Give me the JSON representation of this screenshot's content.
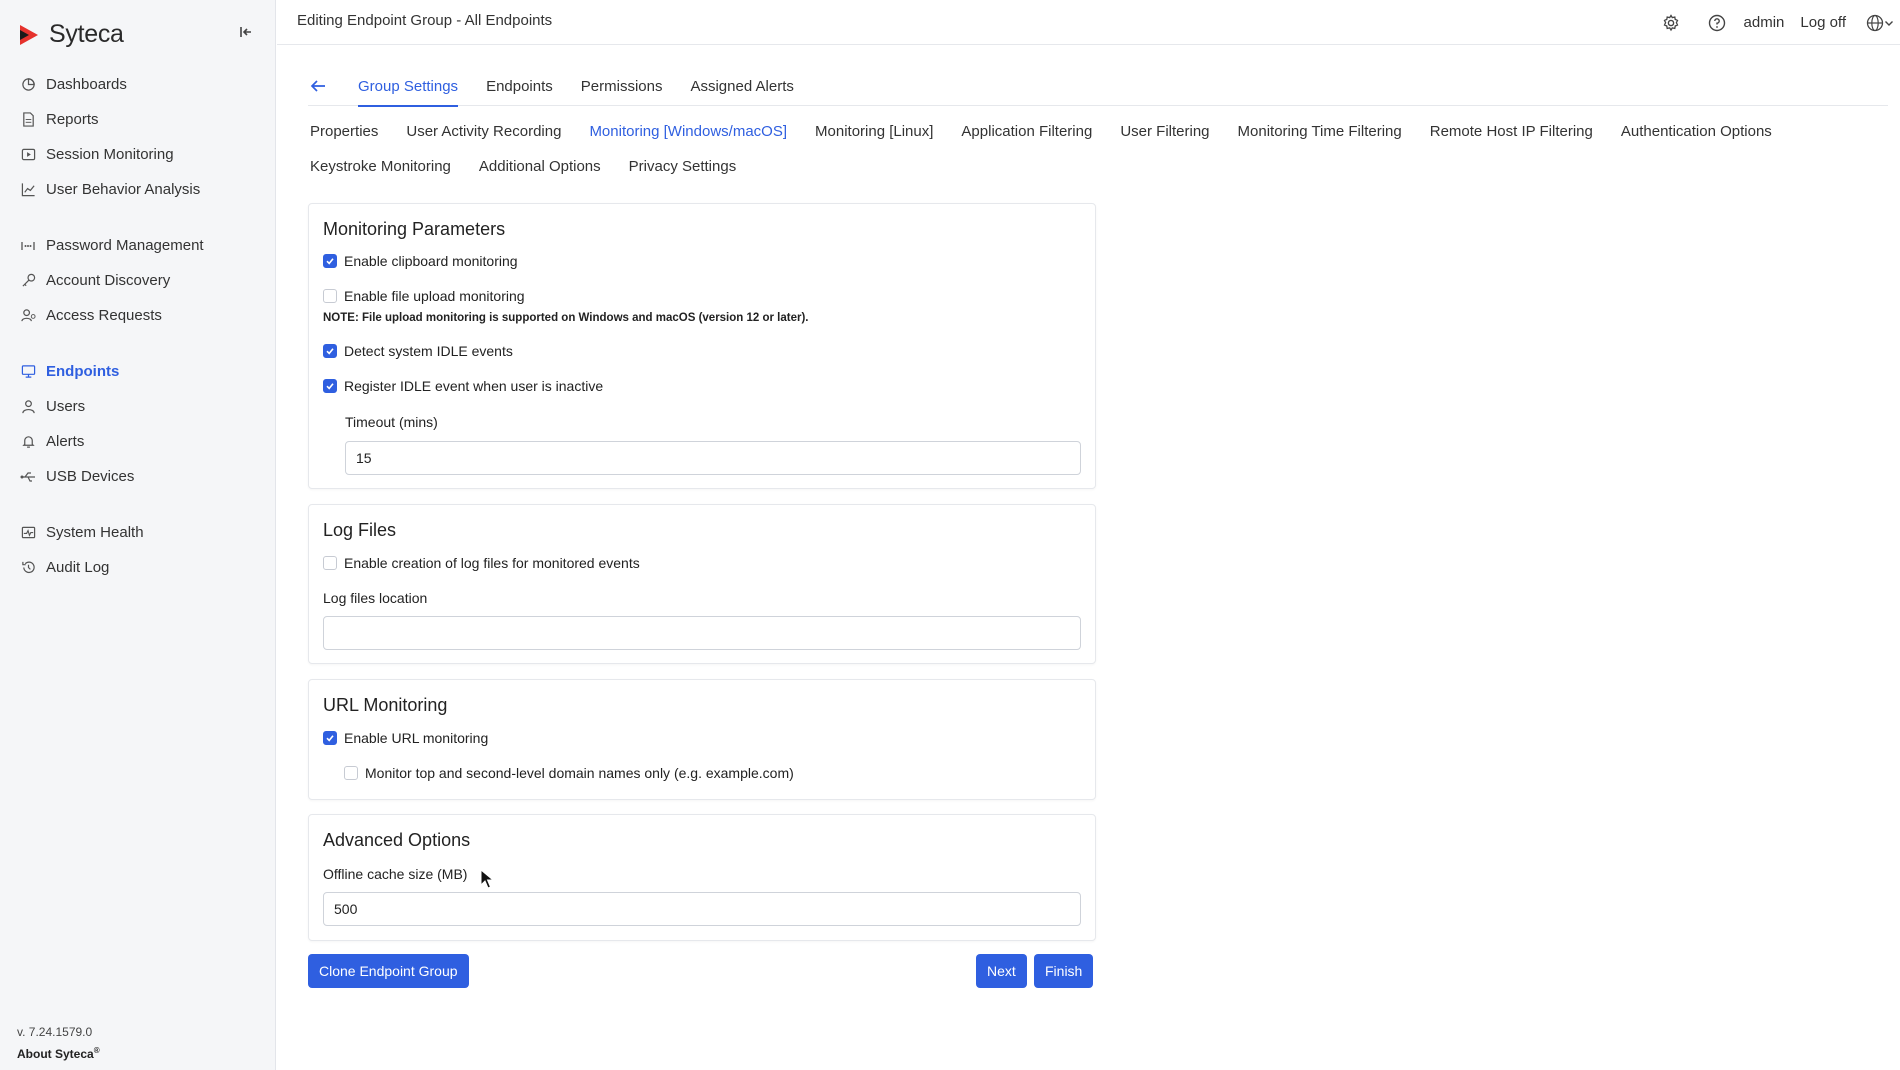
{
  "app": {
    "brand": "Syteca",
    "accent": "#2f5fe0"
  },
  "sidebar": {
    "groups": [
      {
        "items": [
          {
            "label": "Dashboards",
            "icon": "dashboard-icon"
          },
          {
            "label": "Reports",
            "icon": "report-icon"
          },
          {
            "label": "Session Monitoring",
            "icon": "session-icon"
          },
          {
            "label": "User Behavior Analysis",
            "icon": "chart-icon"
          }
        ]
      },
      {
        "items": [
          {
            "label": "Password Management",
            "icon": "password-icon"
          },
          {
            "label": "Account Discovery",
            "icon": "key-icon"
          },
          {
            "label": "Access Requests",
            "icon": "access-icon"
          }
        ]
      },
      {
        "items": [
          {
            "label": "Endpoints",
            "icon": "monitor-icon",
            "active": true
          },
          {
            "label": "Users",
            "icon": "user-icon"
          },
          {
            "label": "Alerts",
            "icon": "bell-icon"
          },
          {
            "label": "USB Devices",
            "icon": "usb-icon"
          }
        ]
      },
      {
        "items": [
          {
            "label": "System Health",
            "icon": "health-icon"
          },
          {
            "label": "Audit Log",
            "icon": "history-icon"
          }
        ]
      }
    ],
    "version": "v. 7.24.1579.0",
    "about": "About Syteca",
    "about_sup": "®"
  },
  "header": {
    "title": "Editing Endpoint Group - All Endpoints",
    "user": "admin",
    "logoff": "Log off"
  },
  "main_tabs": [
    "Group Settings",
    "Endpoints",
    "Permissions",
    "Assigned Alerts"
  ],
  "sub_tabs": [
    "Properties",
    "User Activity Recording",
    "Monitoring [Windows/macOS]",
    "Monitoring [Linux]",
    "Application Filtering",
    "User Filtering",
    "Monitoring Time Filtering",
    "Remote Host IP Filtering",
    "Authentication Options",
    "Keystroke Monitoring",
    "Additional Options",
    "Privacy Settings"
  ],
  "monitoring": {
    "title": "Monitoring Parameters",
    "clipboard": {
      "label": "Enable clipboard monitoring",
      "checked": true
    },
    "file_upload": {
      "label": "Enable file upload monitoring",
      "checked": false
    },
    "note": "NOTE: File upload monitoring is supported on Windows and macOS (version 12 or later).",
    "idle": {
      "label": "Detect system IDLE events",
      "checked": true
    },
    "idle_inactive": {
      "label": "Register IDLE event when user is inactive",
      "checked": true
    },
    "timeout_label": "Timeout (mins)",
    "timeout_value": "15"
  },
  "log_files": {
    "title": "Log Files",
    "enable": {
      "label": "Enable creation of log files for monitored events",
      "checked": false
    },
    "location_label": "Log files location",
    "location_value": ""
  },
  "url_monitoring": {
    "title": "URL Monitoring",
    "enable": {
      "label": "Enable URL monitoring",
      "checked": true
    },
    "domain_only": {
      "label": "Monitor top and second-level domain names only (e.g. example.com)",
      "checked": false
    }
  },
  "advanced": {
    "title": "Advanced Options",
    "cache_label": "Offline cache size (MB)",
    "cache_value": "500"
  },
  "buttons": {
    "clone": "Clone Endpoint Group",
    "next": "Next",
    "finish": "Finish"
  }
}
